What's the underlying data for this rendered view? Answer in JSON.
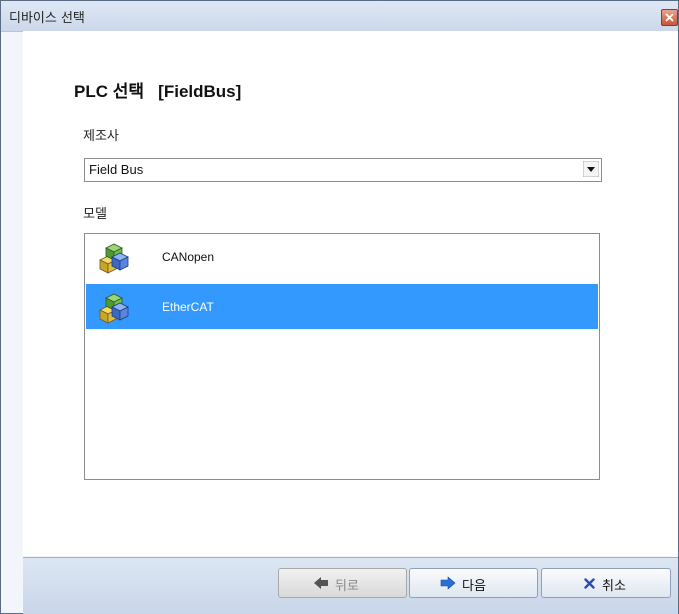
{
  "window": {
    "title": "디바이스 선택"
  },
  "page": {
    "title": "PLC 선택   [FieldBus]"
  },
  "maker": {
    "label": "제조사",
    "selected": "Field Bus"
  },
  "model": {
    "label": "모델",
    "items": [
      {
        "label": "CANopen",
        "icon": "device-cubes-icon",
        "selected": false
      },
      {
        "label": "EtherCAT",
        "icon": "device-cubes-icon",
        "selected": true
      }
    ]
  },
  "footer": {
    "back_label": "뒤로",
    "next_label": "다음",
    "cancel_label": "취소"
  },
  "colors": {
    "selection": "#3399ff",
    "arrow_blue": "#2b6fd6",
    "cancel_blue": "#2a4fb0"
  }
}
